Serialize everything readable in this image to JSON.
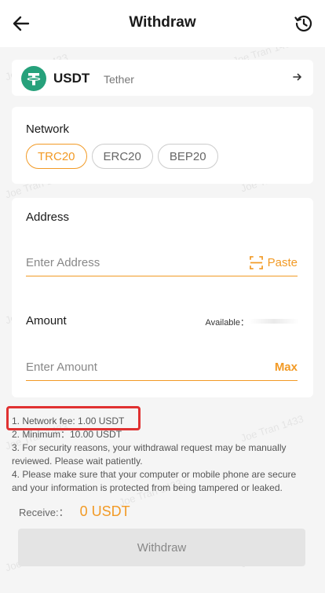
{
  "header": {
    "title": "Withdraw",
    "back_icon": "arrow-left-icon",
    "history_icon": "history-icon"
  },
  "coin": {
    "symbol": "USDT",
    "name": "Tether",
    "logo_icon": "tether-logo",
    "arrow_icon": "arrow-right-icon",
    "logo_color": "#26a17b"
  },
  "network": {
    "label": "Network",
    "options": [
      "TRC20",
      "ERC20",
      "BEP20"
    ],
    "selected": "TRC20"
  },
  "address": {
    "label": "Address",
    "placeholder": "Enter Address",
    "value": "",
    "paste_label": "Paste",
    "scan_icon": "scan-icon"
  },
  "amount": {
    "label": "Amount",
    "available_label": "Available：",
    "placeholder": "Enter Amount",
    "value": "",
    "max_label": "Max"
  },
  "notes": [
    "1. Network fee: 1.00 USDT",
    "2. Minimum：10.00 USDT",
    "3. For security reasons, your withdrawal request may be manually reviewed. Please wait patiently.",
    "4. Please make sure that your computer or mobile phone are secure and your information is protected from being tampered or leaked."
  ],
  "receive": {
    "label": "Receive:：",
    "value": "0 USDT"
  },
  "submit_label": "Withdraw",
  "watermark": "Joe Tran 1433",
  "colors": {
    "accent": "#f29a25",
    "highlight": "#e03131",
    "tether": "#26a17b"
  }
}
